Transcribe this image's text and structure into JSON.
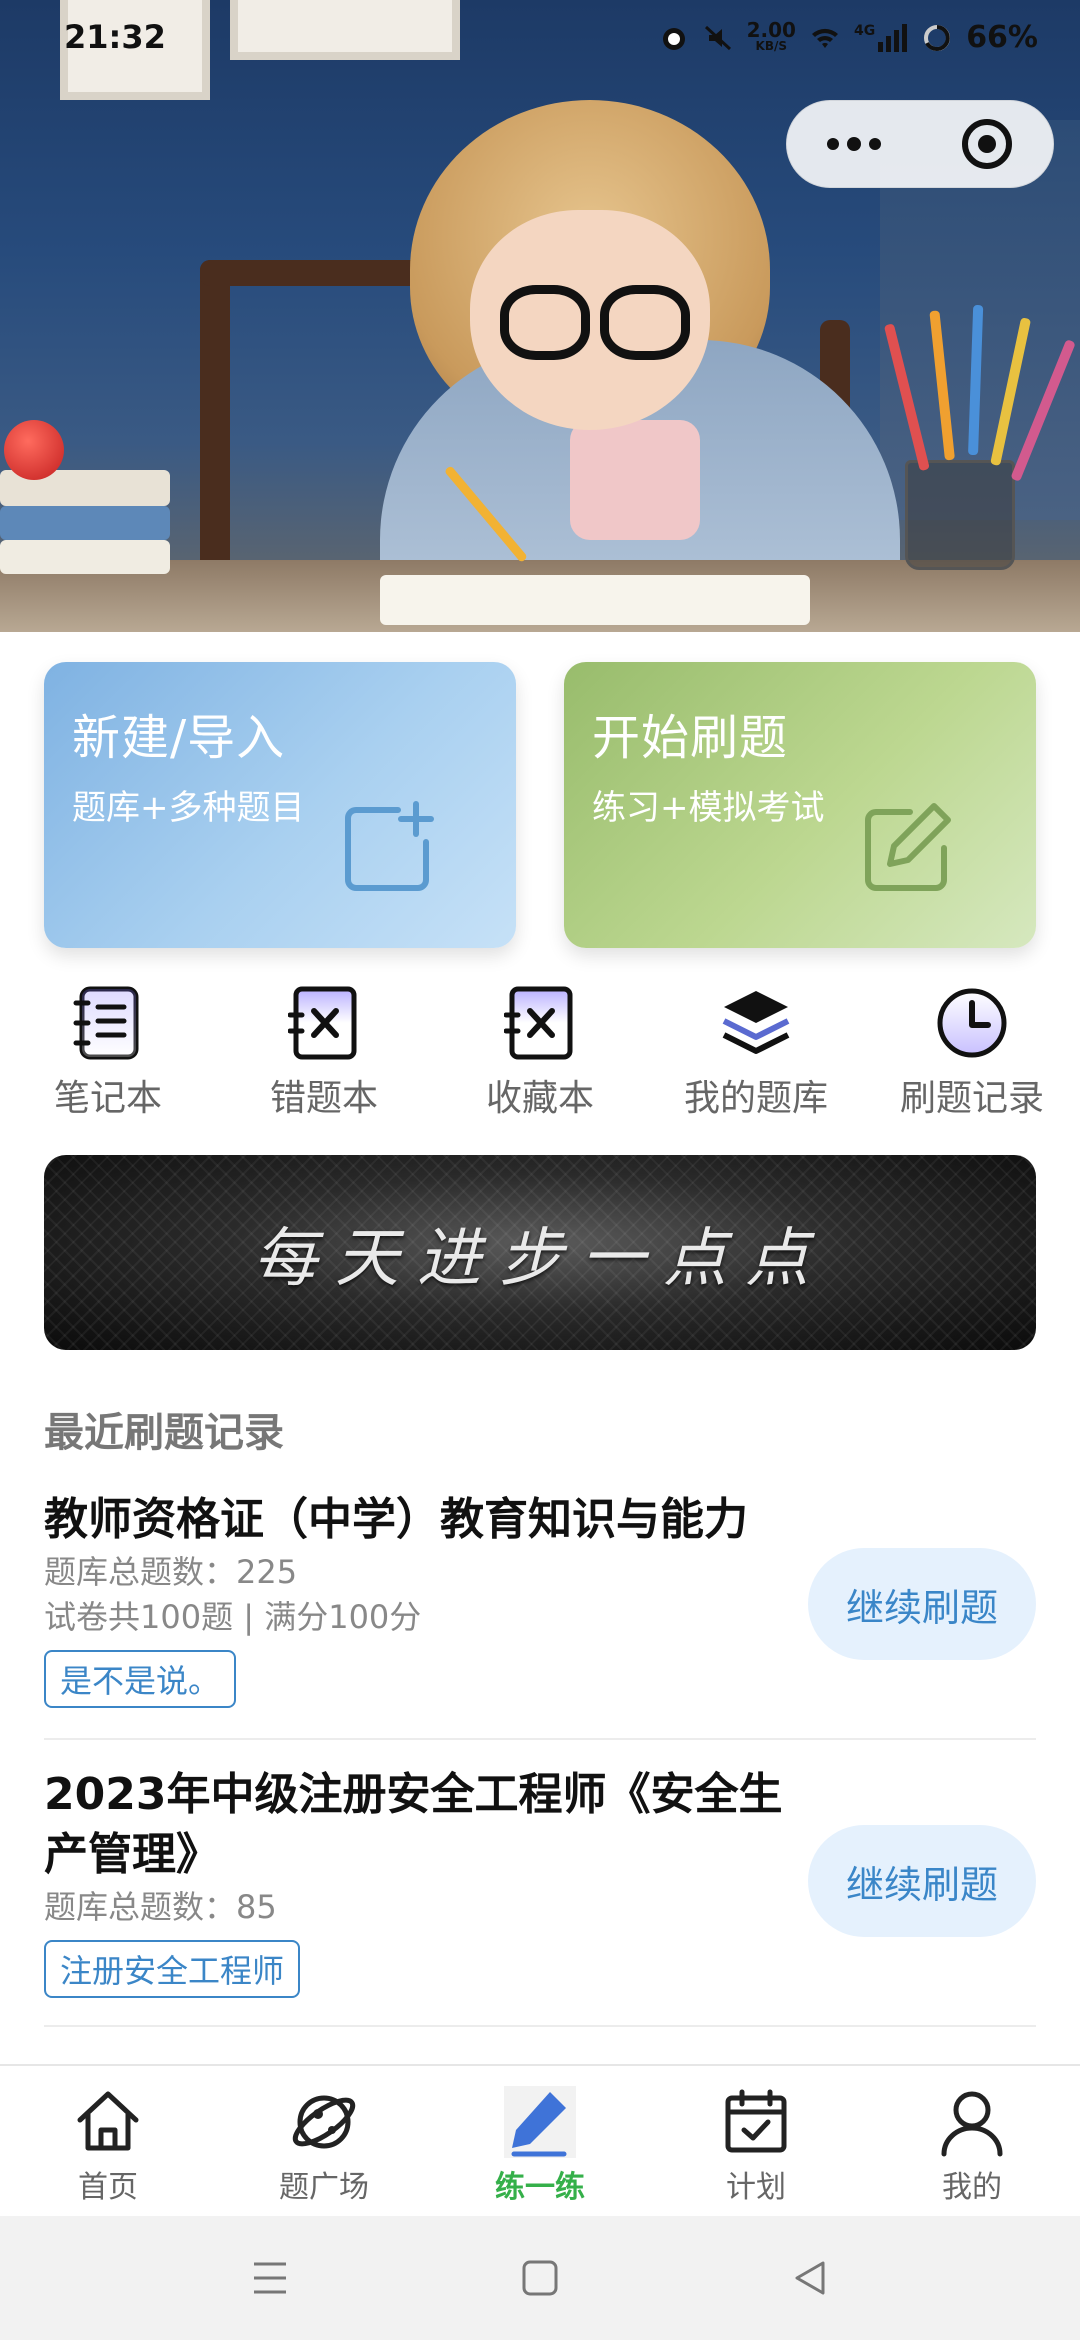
{
  "status_bar": {
    "time": "21:32",
    "net_speed_value": "2.00",
    "net_speed_unit": "KB/S",
    "network": "4G",
    "battery": "66%"
  },
  "hero": {
    "icon": "photo-girl-writing"
  },
  "capsule": {
    "more_icon": "more-dots-icon",
    "close_icon": "target-close-icon"
  },
  "actions": {
    "create": {
      "title": "新建/导入",
      "subtitle": "题库+多种题目",
      "icon": "add-square-icon"
    },
    "practice": {
      "title": "开始刷题",
      "subtitle": "练习+模拟考试",
      "icon": "edit-pencil-icon"
    }
  },
  "quick_menu": [
    {
      "label": "笔记本",
      "icon": "notebook-icon"
    },
    {
      "label": "错题本",
      "icon": "wrong-book-icon"
    },
    {
      "label": "收藏本",
      "icon": "favorite-book-icon"
    },
    {
      "label": "我的题库",
      "icon": "layers-icon"
    },
    {
      "label": "刷题记录",
      "icon": "clock-icon"
    }
  ],
  "banner": {
    "text": "每天进步一点点"
  },
  "recent": {
    "title": "最近刷题记录",
    "records": [
      {
        "title": "教师资格证（中学）教育知识与能力",
        "meta1": "题库总题数：225",
        "meta2": "试卷共100题 | 满分100分",
        "tag": "是不是说。",
        "button": "继续刷题"
      },
      {
        "title": "2023年中级注册安全工程师《安全生产管理》",
        "meta1": "题库总题数：85",
        "tag": "注册安全工程师",
        "button": "继续刷题"
      }
    ]
  },
  "tabs": [
    {
      "label": "首页",
      "icon": "home-icon"
    },
    {
      "label": "题广场",
      "icon": "planet-icon"
    },
    {
      "label": "练一练",
      "icon": "pen-icon",
      "active": true
    },
    {
      "label": "计划",
      "icon": "calendar-check-icon"
    },
    {
      "label": "我的",
      "icon": "user-icon"
    }
  ],
  "colors": {
    "accent_blue": "#3b86c7",
    "active_tab": "#35b04a",
    "card_blue": "#a9d0f0",
    "card_green": "#bcd790"
  }
}
